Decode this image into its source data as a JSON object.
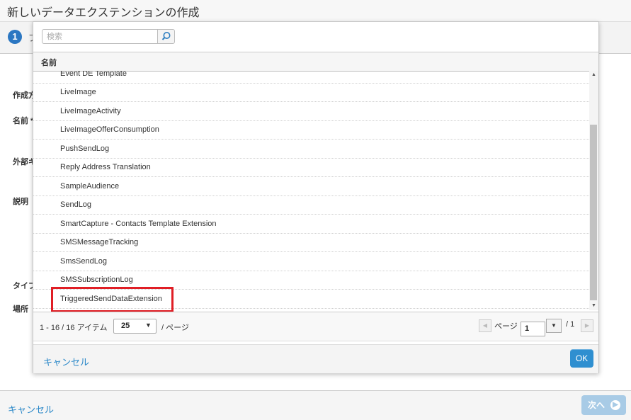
{
  "page": {
    "title": "新しいデータエクステンションの作成",
    "step_number": "1",
    "step_label": "プ",
    "labels": {
      "create_method": "作成方",
      "name": "名前 *",
      "external_key": "外部キ",
      "description": "説明",
      "type": "タイプ",
      "location": "場所"
    },
    "footer": {
      "cancel": "キャンセル",
      "next": "次へ"
    }
  },
  "modal": {
    "search": {
      "placeholder": "検索",
      "value": ""
    },
    "column_header": "名前",
    "rows": [
      "Event DE Template",
      "LiveImage",
      "LiveImageActivity",
      "LiveImageOfferConsumption",
      "PushSendLog",
      "Reply Address Translation",
      "SampleAudience",
      "SendLog",
      "SmartCapture - Contacts Template Extension",
      "SMSMessageTracking",
      "SmsSendLog",
      "SMSSubscriptionLog",
      "TriggeredSendDataExtension"
    ],
    "highlighted_row": "TriggeredSendDataExtension",
    "pager": {
      "items_text": "1 - 16 / 16 アイテム",
      "page_size": "25",
      "per_page": "/ ページ",
      "page_word": "ページ",
      "current_page": "1",
      "total_pages": "/ 1"
    },
    "cancel": "キャンセル",
    "ok": "OK"
  },
  "colors": {
    "accent": "#2f8fd0",
    "link": "#2b88c8",
    "highlight": "#e01e25",
    "next_disabled": "#a8cbe6"
  },
  "icons": {
    "search": "search-icon",
    "next": "arrow-right-icon",
    "scroll_up": "scroll-up-icon",
    "scroll_down": "scroll-down-icon"
  }
}
